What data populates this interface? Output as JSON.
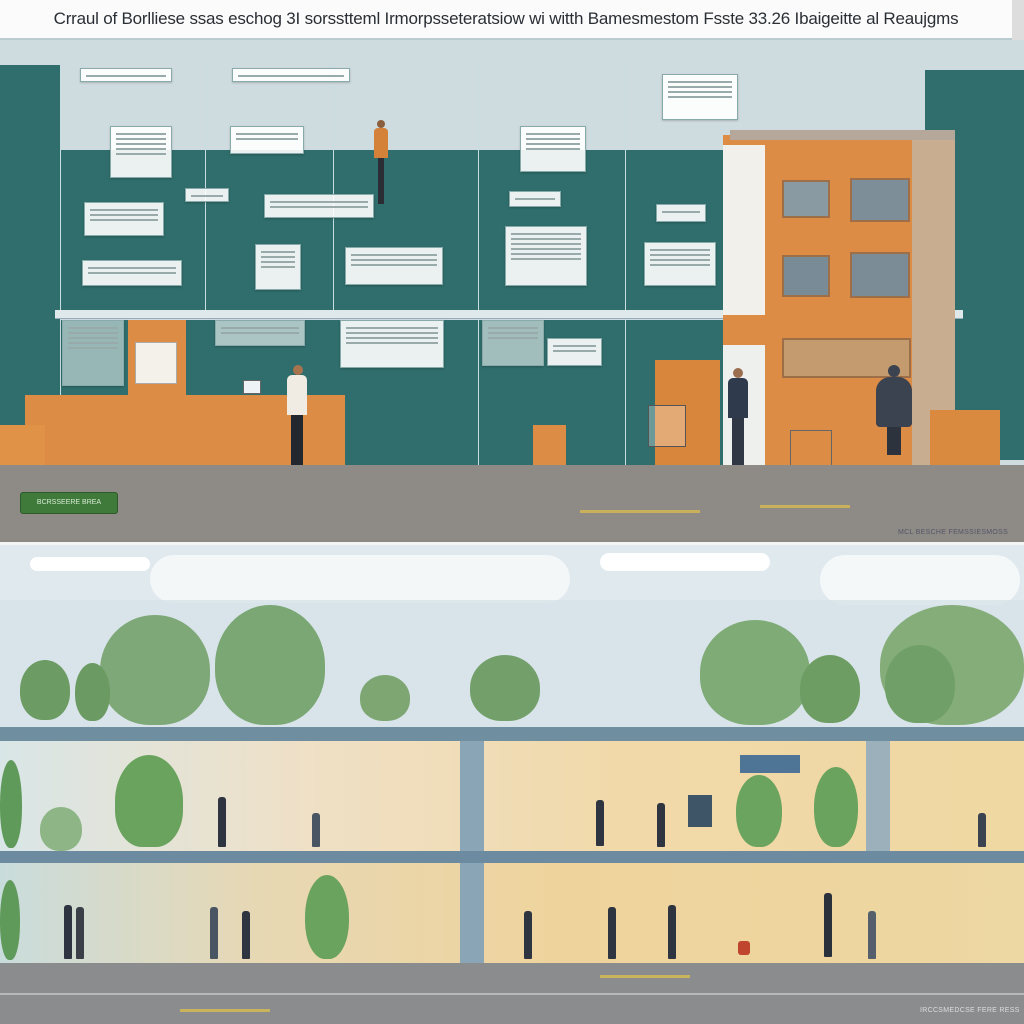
{
  "header": {
    "title": "Crraul of Borlliese ssas eschog 3I sorsstteml Irmorpsseteratsiow wi witth Bamesmestom Fsste 33.26 Ibaigeitte al Reaujgms"
  },
  "top_scene": {
    "badge_text": "BCRSSEERE BREA",
    "corner_caption": "MCL BESCHE FEMSSIESMOSS"
  },
  "bottom_scene": {
    "corner_caption": "IRCCSMEDCSE FERE RESS"
  },
  "colors": {
    "teal": "#2f6e6c",
    "orange": "#dd8c45",
    "road": "#8d8a86",
    "sky": "#dfe9ee"
  }
}
